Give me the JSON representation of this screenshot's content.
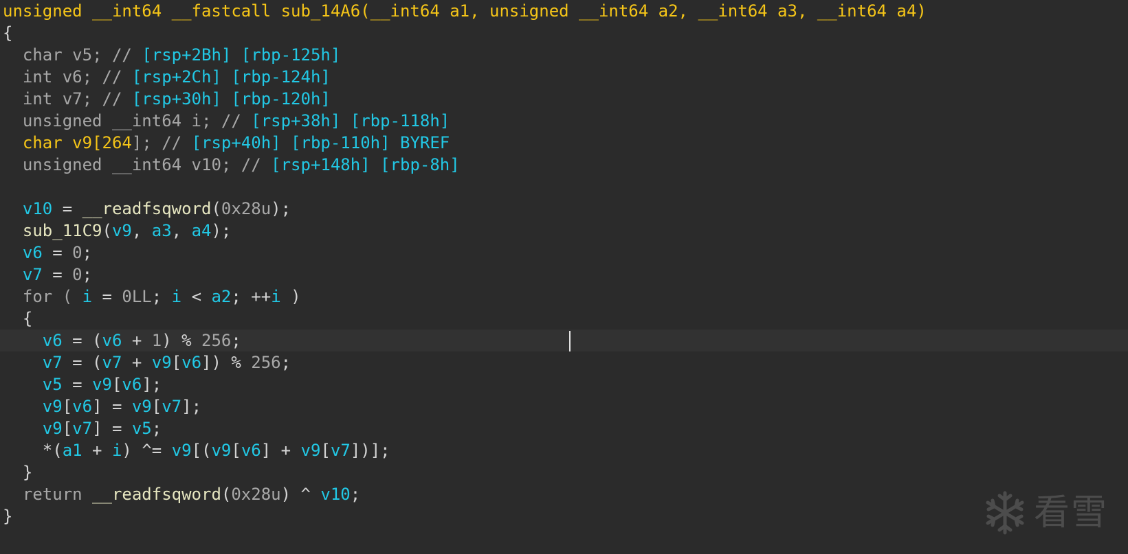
{
  "editor": {
    "lines": [
      [
        [
          "unsigned __int64 __fastcall sub_14A6(__int64 a1, unsigned __int64 a2, __int64 a3, __int64 a4)",
          "kw-y"
        ]
      ],
      [
        [
          "{",
          "pl"
        ]
      ],
      [
        [
          "  char ",
          "ty"
        ],
        [
          "v5",
          "ty"
        ],
        [
          "; // ",
          "cm"
        ],
        [
          "[rsp+2Bh] [rbp-125h]",
          "tagc"
        ]
      ],
      [
        [
          "  int ",
          "ty"
        ],
        [
          "v6",
          "ty"
        ],
        [
          "; // ",
          "cm"
        ],
        [
          "[rsp+2Ch] [rbp-124h]",
          "tagc"
        ]
      ],
      [
        [
          "  int ",
          "ty"
        ],
        [
          "v7",
          "ty"
        ],
        [
          "; // ",
          "cm"
        ],
        [
          "[rsp+30h] [rbp-120h]",
          "tagc"
        ]
      ],
      [
        [
          "  unsigned __int64 ",
          "ty"
        ],
        [
          "i",
          "ty"
        ],
        [
          "; // ",
          "cm"
        ],
        [
          "[rsp+38h] [rbp-118h]",
          "tagc"
        ]
      ],
      [
        [
          "  char v9[",
          "kw-y"
        ],
        [
          "264",
          "kw-y"
        ],
        [
          "]; // ",
          "cm"
        ],
        [
          "[rsp+40h] [rbp-110h] BYREF",
          "tagc"
        ]
      ],
      [
        [
          "  unsigned __int64 ",
          "ty"
        ],
        [
          "v10",
          "ty"
        ],
        [
          "; // ",
          "cm"
        ],
        [
          "[rsp+148h] [rbp-8h]",
          "tagc"
        ]
      ],
      [
        [
          "",
          "pl"
        ]
      ],
      [
        [
          "  ",
          "pl"
        ],
        [
          "v10",
          "id"
        ],
        [
          " = ",
          "pl"
        ],
        [
          "__readfsqword",
          "fn"
        ],
        [
          "(",
          "pl"
        ],
        [
          "0x28u",
          "num"
        ],
        [
          ");",
          "pl"
        ]
      ],
      [
        [
          "  ",
          "pl"
        ],
        [
          "sub_11C9",
          "fn"
        ],
        [
          "(",
          "pl"
        ],
        [
          "v9",
          "id"
        ],
        [
          ", ",
          "pl"
        ],
        [
          "a3",
          "id"
        ],
        [
          ", ",
          "pl"
        ],
        [
          "a4",
          "id"
        ],
        [
          ");",
          "pl"
        ]
      ],
      [
        [
          "  ",
          "pl"
        ],
        [
          "v6",
          "id"
        ],
        [
          " = ",
          "pl"
        ],
        [
          "0",
          "num"
        ],
        [
          ";",
          "pl"
        ]
      ],
      [
        [
          "  ",
          "pl"
        ],
        [
          "v7",
          "id"
        ],
        [
          " = ",
          "pl"
        ],
        [
          "0",
          "num"
        ],
        [
          ";",
          "pl"
        ]
      ],
      [
        [
          "  for ( ",
          "ty"
        ],
        [
          "i",
          "id"
        ],
        [
          " = ",
          "pl"
        ],
        [
          "0LL",
          "num"
        ],
        [
          "; ",
          "pl"
        ],
        [
          "i",
          "id"
        ],
        [
          " < ",
          "pl"
        ],
        [
          "a2",
          "id"
        ],
        [
          "; ++",
          "pl"
        ],
        [
          "i",
          "id"
        ],
        [
          " )",
          "pl"
        ]
      ],
      [
        [
          "  {",
          "pl"
        ]
      ],
      [
        [
          "    ",
          "pl"
        ],
        [
          "v6",
          "id"
        ],
        [
          " = (",
          "pl"
        ],
        [
          "v6",
          "id"
        ],
        [
          " + ",
          "pl"
        ],
        [
          "1",
          "num"
        ],
        [
          ") % ",
          "pl"
        ],
        [
          "256",
          "num"
        ],
        [
          ";",
          "pl"
        ]
      ],
      [
        [
          "    ",
          "pl"
        ],
        [
          "v7",
          "id"
        ],
        [
          " = (",
          "pl"
        ],
        [
          "v7",
          "id"
        ],
        [
          " + ",
          "pl"
        ],
        [
          "v9",
          "id"
        ],
        [
          "[",
          "pl"
        ],
        [
          "v6",
          "id"
        ],
        [
          "]) % ",
          "pl"
        ],
        [
          "256",
          "num"
        ],
        [
          ";",
          "pl"
        ]
      ],
      [
        [
          "    ",
          "pl"
        ],
        [
          "v5",
          "id"
        ],
        [
          " = ",
          "pl"
        ],
        [
          "v9",
          "id"
        ],
        [
          "[",
          "pl"
        ],
        [
          "v6",
          "id"
        ],
        [
          "];",
          "pl"
        ]
      ],
      [
        [
          "    ",
          "pl"
        ],
        [
          "v9",
          "id"
        ],
        [
          "[",
          "pl"
        ],
        [
          "v6",
          "id"
        ],
        [
          "] = ",
          "pl"
        ],
        [
          "v9",
          "id"
        ],
        [
          "[",
          "pl"
        ],
        [
          "v7",
          "id"
        ],
        [
          "];",
          "pl"
        ]
      ],
      [
        [
          "    ",
          "pl"
        ],
        [
          "v9",
          "id"
        ],
        [
          "[",
          "pl"
        ],
        [
          "v7",
          "id"
        ],
        [
          "] = ",
          "pl"
        ],
        [
          "v5",
          "id"
        ],
        [
          ";",
          "pl"
        ]
      ],
      [
        [
          "    *(",
          "pl"
        ],
        [
          "a1",
          "id"
        ],
        [
          " + ",
          "pl"
        ],
        [
          "i",
          "id"
        ],
        [
          ") ^= ",
          "pl"
        ],
        [
          "v9",
          "id"
        ],
        [
          "[(",
          "pl"
        ],
        [
          "v9",
          "id"
        ],
        [
          "[",
          "pl"
        ],
        [
          "v6",
          "id"
        ],
        [
          "] + ",
          "pl"
        ],
        [
          "v9",
          "id"
        ],
        [
          "[",
          "pl"
        ],
        [
          "v7",
          "id"
        ],
        [
          "])];",
          "pl"
        ]
      ],
      [
        [
          "  }",
          "pl"
        ]
      ],
      [
        [
          "  return ",
          "ty"
        ],
        [
          "__readfsqword",
          "fn"
        ],
        [
          "(",
          "pl"
        ],
        [
          "0x28u",
          "num"
        ],
        [
          ") ^ ",
          "pl"
        ],
        [
          "v10",
          "id"
        ],
        [
          ";",
          "pl"
        ]
      ],
      [
        [
          "}",
          "pl"
        ]
      ]
    ],
    "highlighted_line": 15
  },
  "watermark": {
    "text": "看雪"
  }
}
